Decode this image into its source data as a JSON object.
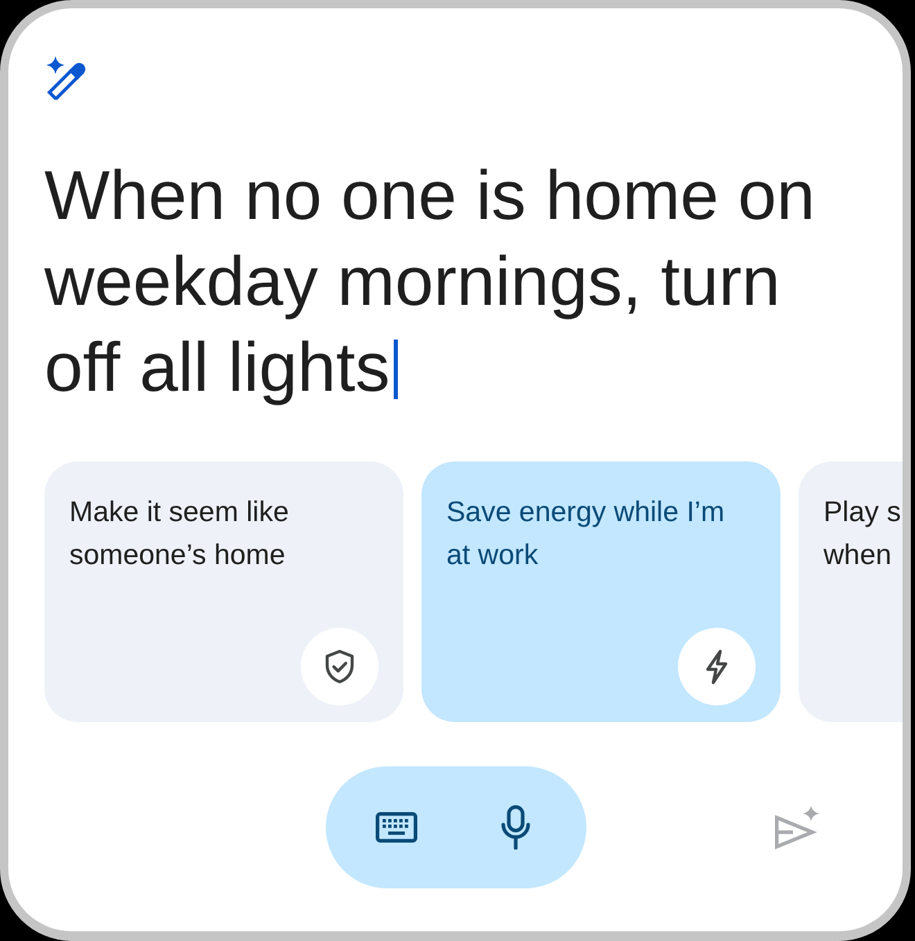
{
  "prompt": {
    "value": "When no one is home on weekday mornings, turn off all lights",
    "focused": true
  },
  "suggestions": [
    {
      "lines": [
        "Make it seem like",
        "someone’s home"
      ],
      "selected": false
    },
    {
      "lines": [
        "Save energy while I’m",
        "at work"
      ],
      "selected": true
    },
    {
      "lines": [
        "Play s",
        "when"
      ],
      "selected": false
    }
  ],
  "send_button": {
    "disabled": true
  }
}
